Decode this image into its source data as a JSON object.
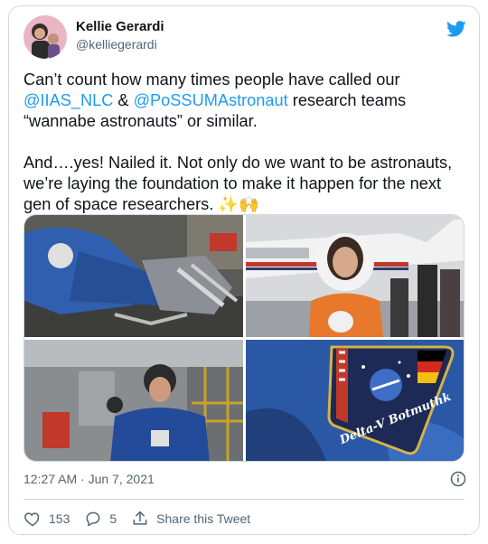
{
  "author": {
    "name": "Kellie Gerardi",
    "handle": "@kelliegerardi"
  },
  "tweet": {
    "line1_pre": "Can’t count how many times people have called our ",
    "mention1": "@IIAS_NLC",
    "amp": " & ",
    "mention2": "@PoSSUMAstronaut",
    "line1_post": " research teams “wannabe astronauts” or similar.",
    "para2": "And….yes! Nailed it. Not only do we want to be astronauts, we’re laying the foundation to make it happen for the next gen of space researchers. ✨🙌"
  },
  "patch_text": "Delta-V Botmuthk",
  "timestamp": "12:27 AM · Jun 7, 2021",
  "actions": {
    "likes": "153",
    "replies": "5",
    "share_label": "Share this Tweet"
  },
  "colors": {
    "accent": "#1d9bf0",
    "text": "#0f1419",
    "secondary": "#536471",
    "border": "#cfd9de"
  },
  "icons": [
    "twitter-bird-icon",
    "info-icon",
    "heart-icon",
    "reply-icon",
    "share-icon"
  ]
}
